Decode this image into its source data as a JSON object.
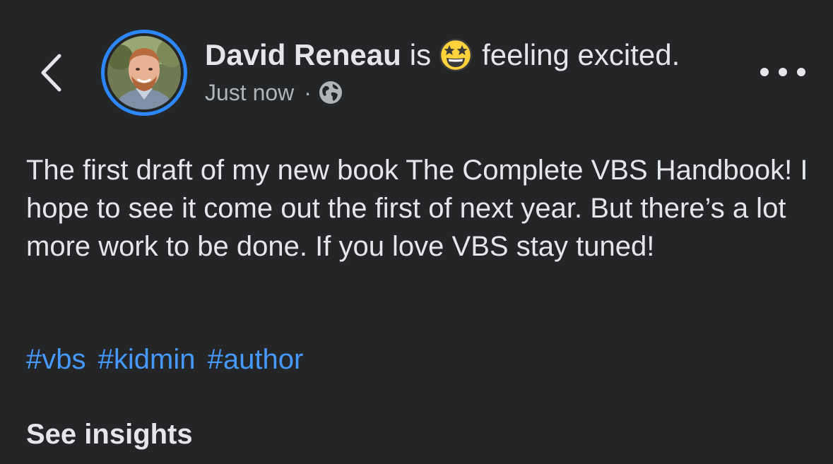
{
  "header": {
    "author_name": "David Reneau",
    "activity_verb": "is",
    "feeling_text": "feeling excited.",
    "feeling_emoji": "star-struck-emoji",
    "timestamp": "Just now",
    "separator": "·",
    "audience_icon": "globe-icon",
    "back_icon": "chevron-left-icon",
    "more_icon": "more-horizontal-icon"
  },
  "post": {
    "body": "The first draft of my new book The Complete VBS Handbook! I hope to see it come out the first of next year. But there’s a lot more work to be done. If you love VBS stay tuned!",
    "hashtags": [
      "#vbs",
      "#kidmin",
      "#author"
    ]
  },
  "footer": {
    "insights_label": "See insights"
  },
  "colors": {
    "background": "#242526",
    "primary_text": "#e4e6eb",
    "secondary_text": "#b0b3b8",
    "hashtag": "#4599ff",
    "story_ring": "#2d88ff",
    "emoji_face": "#ffd23c"
  }
}
